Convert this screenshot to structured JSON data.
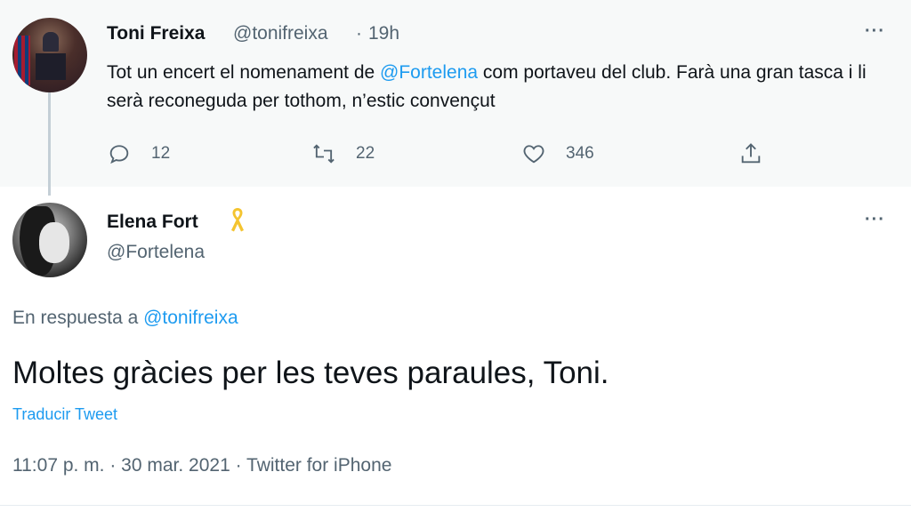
{
  "tweet1": {
    "author_name": "Toni Freixa",
    "author_handle": "@tonifreixa",
    "separator": "·",
    "time": "19h",
    "text_before": "Tot un encert el nomenament de ",
    "mention": "@Fortelena",
    "text_after": " com portaveu del club. Farà una gran tasca i li serà reconeguda per tothom, n’estic convençut",
    "replies": "12",
    "retweets": "22",
    "likes": "346",
    "more_label": "···"
  },
  "tweet2": {
    "author_name": "Elena Fort",
    "author_handle": "@Fortelena",
    "more_label": "···",
    "reply_prefix": "En respuesta a ",
    "reply_handle": "@tonifreixa",
    "text": "Moltes gràcies per les teves paraules, Toni.",
    "translate_label": "Traducir Tweet",
    "timestamp": "11:07 p. m. · 30 mar. 2021 · Twitter for iPhone"
  },
  "colors": {
    "accent": "#1d9bf0",
    "muted": "#536471",
    "text": "#0f1419",
    "background_highlight": "#f7f9f9",
    "ribbon": "#f4c430"
  },
  "icons": [
    "reply-icon",
    "retweet-icon",
    "like-icon",
    "share-icon",
    "more-icon",
    "yellow-ribbon-icon"
  ]
}
